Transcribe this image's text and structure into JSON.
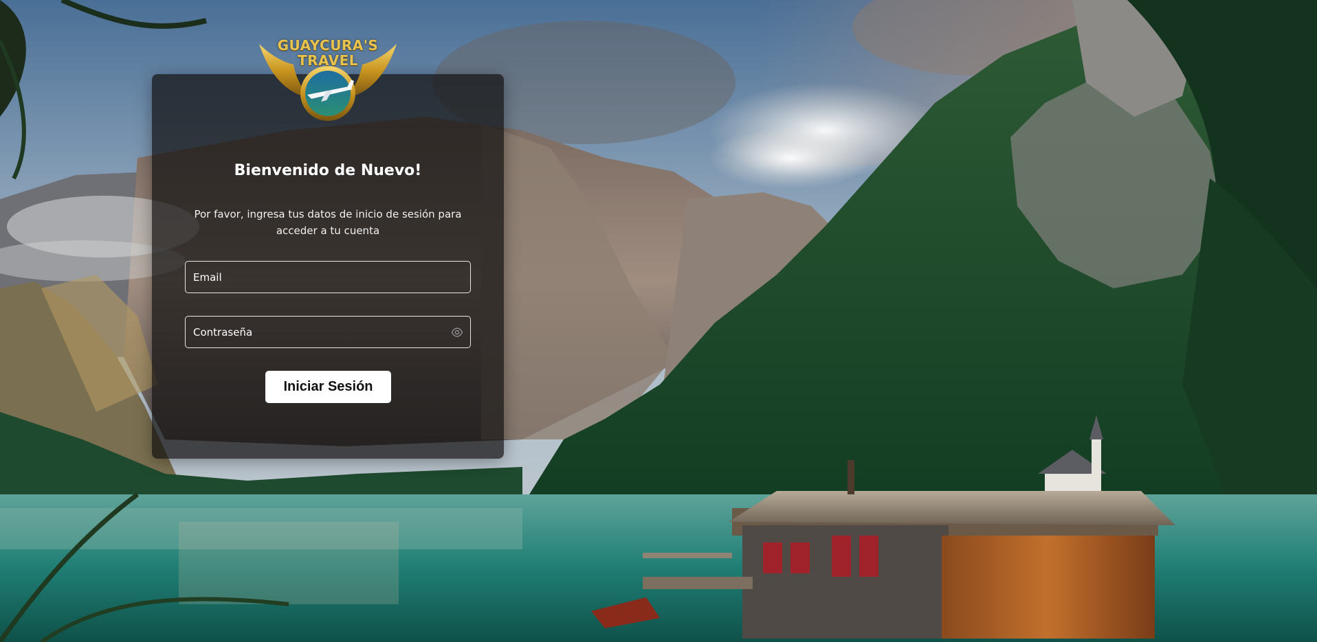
{
  "brand": {
    "line1": "GUAYCURA'S",
    "line2": "TRAVEL"
  },
  "login": {
    "title": "Bienvenido de Nuevo!",
    "subtitle": "Por favor, ingresa tus datos de inicio de sesión para acceder a tu cuenta",
    "email_placeholder": "Email",
    "password_placeholder": "Contraseña",
    "submit_label": "Iniciar Sesión"
  },
  "icons": {
    "password_toggle": "eye-icon"
  },
  "colors": {
    "card_background": "#121010",
    "button_background": "#ffffff",
    "logo_gold": "#e6c24e"
  }
}
